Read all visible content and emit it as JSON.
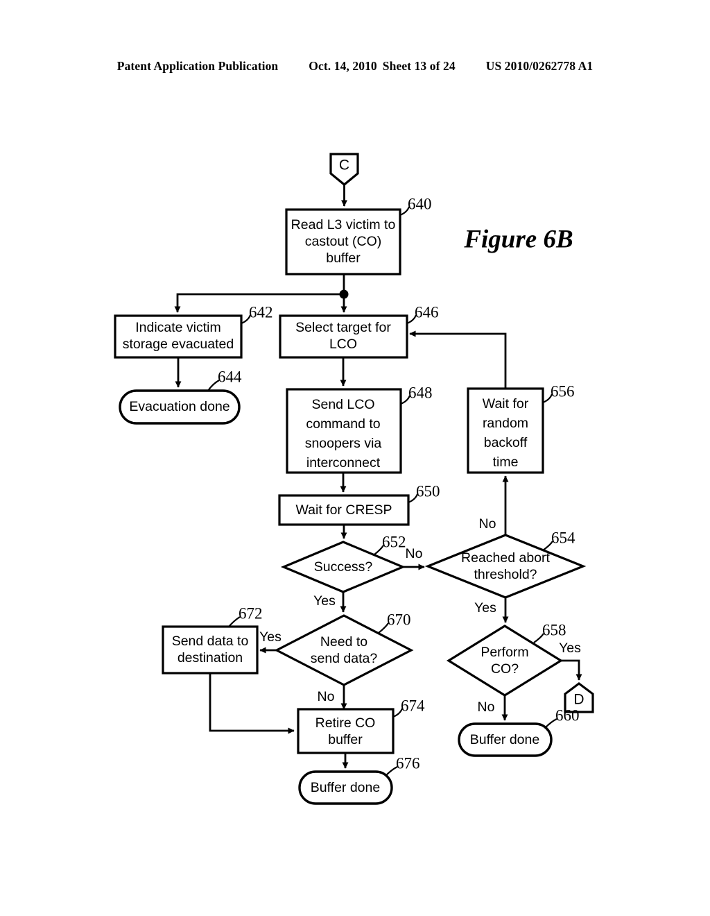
{
  "header": {
    "publication": "Patent Application Publication",
    "date": "Oct. 14, 2010",
    "sheet": "Sheet 13 of 24",
    "patent_number": "US 2010/0262778 A1"
  },
  "figure": {
    "title": "Figure 6B"
  },
  "connectors": {
    "entry": {
      "label": "C"
    },
    "exit": {
      "label": "D"
    }
  },
  "nodes": {
    "n640": {
      "ref": "640",
      "line1": "Read L3 victim to",
      "line2": "castout (CO)",
      "line3": "buffer"
    },
    "n642": {
      "ref": "642",
      "line1": "Indicate victim",
      "line2": "storage evacuated"
    },
    "n644": {
      "ref": "644",
      "line1": "Evacuation done"
    },
    "n646": {
      "ref": "646",
      "line1": "Select target for",
      "line2": "LCO"
    },
    "n648": {
      "ref": "648",
      "line1": "Send LCO",
      "line2": "command to",
      "line3": "snoopers via",
      "line4": "interconnect"
    },
    "n650": {
      "ref": "650",
      "line1": "Wait for CRESP"
    },
    "n652": {
      "ref": "652",
      "line1": "Success?"
    },
    "n654": {
      "ref": "654",
      "line1": "Reached abort",
      "line2": "threshold?"
    },
    "n656": {
      "ref": "656",
      "line1": "Wait for",
      "line2": "random",
      "line3": "backoff",
      "line4": "time"
    },
    "n658": {
      "ref": "658",
      "line1": "Perform",
      "line2": "CO?"
    },
    "n660": {
      "ref": "660",
      "line1": "Buffer done"
    },
    "n670": {
      "ref": "670",
      "line1": "Need to",
      "line2": "send data?"
    },
    "n672": {
      "ref": "672",
      "line1": "Send data to",
      "line2": "destination"
    },
    "n674": {
      "ref": "674",
      "line1": "Retire CO",
      "line2": "buffer"
    },
    "n676": {
      "ref": "676",
      "line1": "Buffer done"
    }
  },
  "branch_labels": {
    "b652_no": "No",
    "b652_yes": "Yes",
    "b654_no": "No",
    "b654_yes": "Yes",
    "b658_yes": "Yes",
    "b658_no": "No",
    "b670_yes": "Yes",
    "b670_no": "No"
  },
  "colors": {
    "ink": "#000000",
    "paper": "#ffffff"
  }
}
